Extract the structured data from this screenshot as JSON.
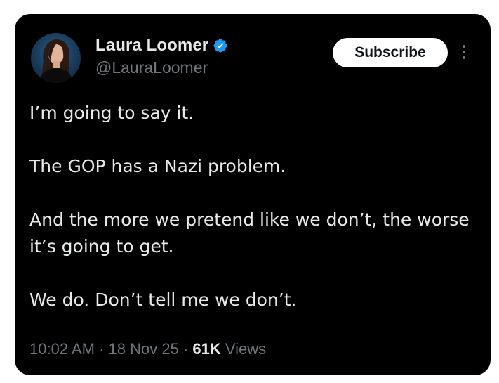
{
  "author": {
    "display_name": "Laura Loomer",
    "handle": "@LauraLoomer",
    "verified": true,
    "verified_color": "#1d9bf0",
    "avatar_icon": "profile-photo"
  },
  "actions": {
    "subscribe_label": "Subscribe",
    "more_icon": "more-vertical-icon"
  },
  "tweet": {
    "paragraphs": [
      "I’m going to say it.",
      "The GOP has a Nazi problem.",
      "And the more we pretend like we don’t, the worse it’s going to get.",
      "We do. Don’t tell me we don’t."
    ]
  },
  "meta": {
    "time": "10:02 AM",
    "separator": "·",
    "date": "18 Nov 25",
    "views_count": "61K",
    "views_label": "Views"
  },
  "colors": {
    "background": "#000000",
    "primary_text": "#e7e9ea",
    "secondary_text": "#71767b"
  }
}
